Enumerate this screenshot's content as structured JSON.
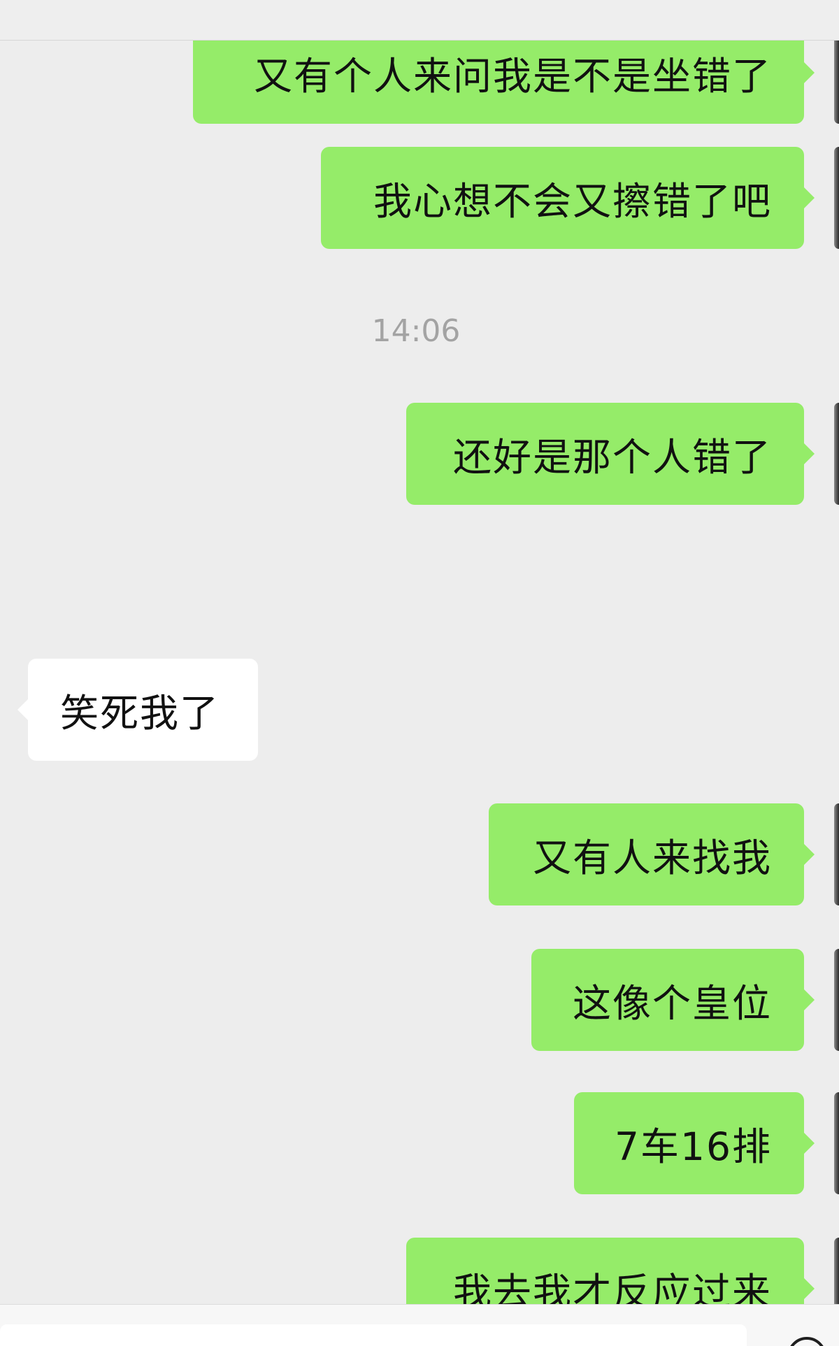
{
  "messages": [
    {
      "side": "out",
      "text": "又有个人来问我是不是坐错了"
    },
    {
      "side": "out",
      "text": "我心想不会又擦错了吧"
    },
    {
      "side": "out",
      "text": "还好是那个人错了"
    },
    {
      "side": "in",
      "text": "笑死我了"
    },
    {
      "side": "out",
      "text": "又有人来找我"
    },
    {
      "side": "out",
      "text": "这像个皇位"
    },
    {
      "side": "out",
      "text": "7车16排"
    },
    {
      "side": "out",
      "text": "我去我才反应过来"
    }
  ],
  "timestamp": "14:06",
  "icons": {
    "emoji": "emoji-icon"
  },
  "colors": {
    "chat_background": "#ededed",
    "outgoing_bubble": "#95ec69",
    "incoming_bubble": "#ffffff",
    "timestamp_text": "#a3a3a3"
  }
}
